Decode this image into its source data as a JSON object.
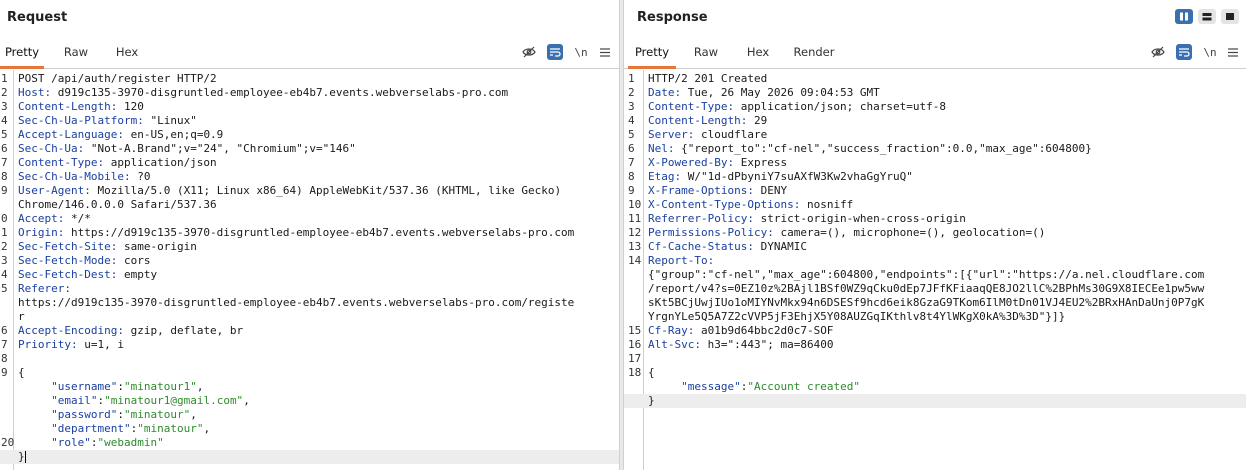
{
  "request": {
    "title": "Request",
    "tabs": [
      "Pretty",
      "Raw",
      "Hex"
    ],
    "active_tab": "Pretty",
    "icons": {
      "hide": "eye-slash-icon",
      "format": "wrap-lines-icon",
      "newline": "\\n",
      "menu": "hamburger-menu-icon"
    },
    "lines": [
      {
        "n": "1",
        "parts": [
          {
            "t": "POST /api/auth/register HTTP/2"
          }
        ]
      },
      {
        "n": "2",
        "parts": [
          {
            "t": "Host:",
            "c": "hname"
          },
          {
            "t": " d919c135-3970-disgruntled-employee-eb4b7.events.webverselabs-pro.com"
          }
        ]
      },
      {
        "n": "3",
        "parts": [
          {
            "t": "Content-Length:",
            "c": "hname"
          },
          {
            "t": " 120"
          }
        ]
      },
      {
        "n": "4",
        "parts": [
          {
            "t": "Sec-Ch-Ua-Platform:",
            "c": "hname"
          },
          {
            "t": " \"Linux\""
          }
        ]
      },
      {
        "n": "5",
        "parts": [
          {
            "t": "Accept-Language:",
            "c": "hname"
          },
          {
            "t": " en-US,en;q=0.9"
          }
        ]
      },
      {
        "n": "6",
        "parts": [
          {
            "t": "Sec-Ch-Ua:",
            "c": "hname"
          },
          {
            "t": " \"Not-A.Brand\";v=\"24\", \"Chromium\";v=\"146\""
          }
        ]
      },
      {
        "n": "7",
        "parts": [
          {
            "t": "Content-Type:",
            "c": "hname"
          },
          {
            "t": " application/json"
          }
        ]
      },
      {
        "n": "8",
        "parts": [
          {
            "t": "Sec-Ch-Ua-Mobile:",
            "c": "hname"
          },
          {
            "t": " ?0"
          }
        ]
      },
      {
        "n": "9",
        "parts": [
          {
            "t": "User-Agent:",
            "c": "hname"
          },
          {
            "t": " Mozilla/5.0 (X11; Linux x86_64) AppleWebKit/537.36 (KHTML, like Gecko)"
          }
        ]
      },
      {
        "n": "",
        "parts": [
          {
            "t": "Chrome/146.0.0.0 Safari/537.36"
          }
        ]
      },
      {
        "n": "0",
        "parts": [
          {
            "t": "Accept:",
            "c": "hname"
          },
          {
            "t": " */*"
          }
        ]
      },
      {
        "n": "1",
        "parts": [
          {
            "t": "Origin:",
            "c": "hname"
          },
          {
            "t": " https://d919c135-3970-disgruntled-employee-eb4b7.events.webverselabs-pro.com"
          }
        ]
      },
      {
        "n": "2",
        "parts": [
          {
            "t": "Sec-Fetch-Site:",
            "c": "hname"
          },
          {
            "t": " same-origin"
          }
        ]
      },
      {
        "n": "3",
        "parts": [
          {
            "t": "Sec-Fetch-Mode:",
            "c": "hname"
          },
          {
            "t": " cors"
          }
        ]
      },
      {
        "n": "4",
        "parts": [
          {
            "t": "Sec-Fetch-Dest:",
            "c": "hname"
          },
          {
            "t": " empty"
          }
        ]
      },
      {
        "n": "5",
        "parts": [
          {
            "t": "Referer:",
            "c": "hname"
          }
        ]
      },
      {
        "n": "",
        "parts": [
          {
            "t": "https://d919c135-3970-disgruntled-employee-eb4b7.events.webverselabs-pro.com/registe"
          }
        ]
      },
      {
        "n": "",
        "parts": [
          {
            "t": "r"
          }
        ]
      },
      {
        "n": "6",
        "parts": [
          {
            "t": "Accept-Encoding:",
            "c": "hname"
          },
          {
            "t": " gzip, deflate, br"
          }
        ]
      },
      {
        "n": "7",
        "parts": [
          {
            "t": "Priority:",
            "c": "hname"
          },
          {
            "t": " u=1, i"
          }
        ]
      },
      {
        "n": "8",
        "parts": []
      },
      {
        "n": "9",
        "parts": [
          {
            "t": "{"
          }
        ]
      },
      {
        "n": "",
        "parts": [
          {
            "t": "     "
          },
          {
            "t": "\"username\"",
            "c": "jkey"
          },
          {
            "t": ":"
          },
          {
            "t": "\"minatour1\"",
            "c": "jval"
          },
          {
            "t": ","
          }
        ]
      },
      {
        "n": "",
        "parts": [
          {
            "t": "     "
          },
          {
            "t": "\"email\"",
            "c": "jkey"
          },
          {
            "t": ":"
          },
          {
            "t": "\"minatour1@gmail.com\"",
            "c": "jval"
          },
          {
            "t": ","
          }
        ]
      },
      {
        "n": "",
        "parts": [
          {
            "t": "     "
          },
          {
            "t": "\"password\"",
            "c": "jkey"
          },
          {
            "t": ":"
          },
          {
            "t": "\"minatour\"",
            "c": "jval"
          },
          {
            "t": ","
          }
        ]
      },
      {
        "n": "",
        "parts": [
          {
            "t": "     "
          },
          {
            "t": "\"department\"",
            "c": "jkey"
          },
          {
            "t": ":"
          },
          {
            "t": "\"minatour\"",
            "c": "jval"
          },
          {
            "t": ","
          }
        ]
      },
      {
        "n": "20",
        "parts": [
          {
            "t": "     "
          },
          {
            "t": "\"role\"",
            "c": "jkey"
          },
          {
            "t": ":"
          },
          {
            "t": "\"webadmin\"",
            "c": "jval"
          }
        ]
      },
      {
        "n": "",
        "parts": [
          {
            "t": "}"
          }
        ],
        "highlight": true,
        "cursor": true
      }
    ]
  },
  "response": {
    "title": "Response",
    "tabs": [
      "Pretty",
      "Raw",
      "Hex",
      "Render"
    ],
    "active_tab": "Pretty",
    "lines": [
      {
        "n": "1",
        "parts": [
          {
            "t": "HTTP/2 201 Created"
          }
        ]
      },
      {
        "n": "2",
        "parts": [
          {
            "t": "Date:",
            "c": "hname"
          },
          {
            "t": " Tue, 26 May 2026 09:04:53 GMT"
          }
        ]
      },
      {
        "n": "3",
        "parts": [
          {
            "t": "Content-Type:",
            "c": "hname"
          },
          {
            "t": " application/json; charset=utf-8"
          }
        ]
      },
      {
        "n": "4",
        "parts": [
          {
            "t": "Content-Length:",
            "c": "hname"
          },
          {
            "t": " 29"
          }
        ]
      },
      {
        "n": "5",
        "parts": [
          {
            "t": "Server:",
            "c": "hname"
          },
          {
            "t": " cloudflare"
          }
        ]
      },
      {
        "n": "6",
        "parts": [
          {
            "t": "Nel:",
            "c": "hname"
          },
          {
            "t": " {\"report_to\":\"cf-nel\",\"success_fraction\":0.0,\"max_age\":604800}"
          }
        ]
      },
      {
        "n": "7",
        "parts": [
          {
            "t": "X-Powered-By:",
            "c": "hname"
          },
          {
            "t": " Express"
          }
        ]
      },
      {
        "n": "8",
        "parts": [
          {
            "t": "Etag:",
            "c": "hname"
          },
          {
            "t": " W/\"1d-dPbyniY7suAXfW3Kw2vhaGgYruQ\""
          }
        ]
      },
      {
        "n": "9",
        "parts": [
          {
            "t": "X-Frame-Options:",
            "c": "hname"
          },
          {
            "t": " DENY"
          }
        ]
      },
      {
        "n": "10",
        "parts": [
          {
            "t": "X-Content-Type-Options:",
            "c": "hname"
          },
          {
            "t": " nosniff"
          }
        ]
      },
      {
        "n": "11",
        "parts": [
          {
            "t": "Referrer-Policy:",
            "c": "hname"
          },
          {
            "t": " strict-origin-when-cross-origin"
          }
        ]
      },
      {
        "n": "12",
        "parts": [
          {
            "t": "Permissions-Policy:",
            "c": "hname"
          },
          {
            "t": " camera=(), microphone=(), geolocation=()"
          }
        ]
      },
      {
        "n": "13",
        "parts": [
          {
            "t": "Cf-Cache-Status:",
            "c": "hname"
          },
          {
            "t": " DYNAMIC"
          }
        ]
      },
      {
        "n": "14",
        "parts": [
          {
            "t": "Report-To:",
            "c": "hname"
          }
        ]
      },
      {
        "n": "",
        "parts": [
          {
            "t": "{\"group\":\"cf-nel\",\"max_age\":604800,\"endpoints\":[{\"url\":\"https://a.nel.cloudflare.com"
          }
        ]
      },
      {
        "n": "",
        "parts": [
          {
            "t": "/report/v4?s=0EZ10z%2BAjl1BSf0WZ9qCku0dEp7JFfKFiaaqQE8JO2llC%2BPhMs30G9X8IECEe1pw5ww"
          }
        ]
      },
      {
        "n": "",
        "parts": [
          {
            "t": "sKt5BCjUwjIUo1oMIYNvMkx94n6DSESf9hcd6eik8GzaG9TKom6IlM0tDn01VJ4EU2%2BRxHAnDaUnj0P7gK"
          }
        ]
      },
      {
        "n": "",
        "parts": [
          {
            "t": "YrgnYLe5Q5A7Z2cVVP5jF3EhjX5Y08AUZGqIKthlv8t4YlWKgX0kA%3D%3D\"}]}"
          }
        ]
      },
      {
        "n": "15",
        "parts": [
          {
            "t": "Cf-Ray:",
            "c": "hname"
          },
          {
            "t": " a01b9d64bbc2d0c7-SOF"
          }
        ]
      },
      {
        "n": "16",
        "parts": [
          {
            "t": "Alt-Svc:",
            "c": "hname"
          },
          {
            "t": " h3=\":443\"; ma=86400"
          }
        ]
      },
      {
        "n": "17",
        "parts": []
      },
      {
        "n": "18",
        "parts": [
          {
            "t": "{"
          }
        ]
      },
      {
        "n": "",
        "parts": [
          {
            "t": "     "
          },
          {
            "t": "\"message\"",
            "c": "jkey"
          },
          {
            "t": ":"
          },
          {
            "t": "\"Account created\"",
            "c": "jval"
          }
        ]
      },
      {
        "n": "",
        "parts": [
          {
            "t": "}"
          }
        ],
        "highlight": true
      }
    ]
  },
  "colors": {
    "accent_tab": "#e8753a",
    "active_icon": "#3a6fb0",
    "header_name": "#1a3fa0",
    "json_value": "#2e8b2e"
  }
}
